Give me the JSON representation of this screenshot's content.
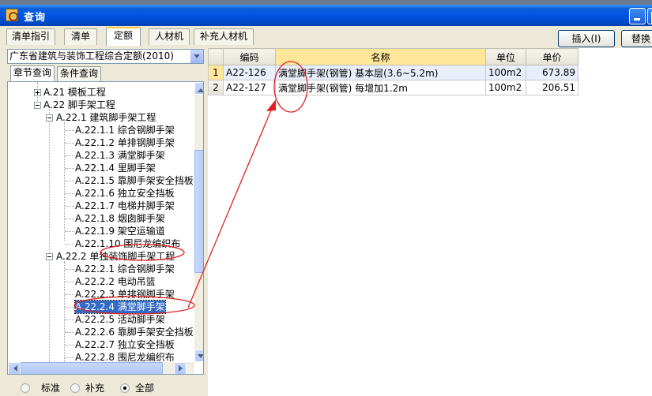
{
  "window": {
    "title": "查询"
  },
  "tabs": [
    {
      "label": "清单指引",
      "active": false
    },
    {
      "label": "清单",
      "active": false
    },
    {
      "label": "定额",
      "active": true
    },
    {
      "label": "人材机",
      "active": false
    },
    {
      "label": "补充人材机",
      "active": false
    }
  ],
  "buttons": {
    "insert": "插入(I)",
    "replace": "替换"
  },
  "quota_library": {
    "selected": "广东省建筑与装饰工程综合定额(2010)"
  },
  "subtabs": [
    {
      "label": "章节查询",
      "active": true
    },
    {
      "label": "条件查询",
      "active": false
    }
  ],
  "tree": [
    {
      "label": "A.21 模板工程"
    },
    {
      "label": "A.22 脚手架工程"
    },
    {
      "label": "A.22.1 建筑脚手架工程"
    },
    {
      "label": "A.22.1.1 综合钢脚手架"
    },
    {
      "label": "A.22.1.2 单排钢脚手架"
    },
    {
      "label": "A.22.1.3 满堂脚手架"
    },
    {
      "label": "A.22.1.4 里脚手架"
    },
    {
      "label": "A.22.1.5 靠脚手架安全挡板"
    },
    {
      "label": "A.22.1.6 独立安全挡板"
    },
    {
      "label": "A.22.1.7 电梯井脚手架"
    },
    {
      "label": "A.22.1.8 烟囱脚手架"
    },
    {
      "label": "A.22.1.9 架空运输道"
    },
    {
      "label": "A.22.1.10 围尼龙编织布"
    },
    {
      "label": "A.22.2 单独装饰脚手架工程"
    },
    {
      "label": "A.22.2.1 综合钢脚手架"
    },
    {
      "label": "A.22.2.2 电动吊篮"
    },
    {
      "label": "A.22.2.3 单排钢脚手架"
    },
    {
      "label": "A.22.2.4 满堂脚手架"
    },
    {
      "label": "A.22.2.5 活动脚手架"
    },
    {
      "label": "A.22.2.6 靠脚手架安全挡板"
    },
    {
      "label": "A.22.2.7 独立安全挡板"
    },
    {
      "label": "A.22.2.8 围尼龙编织布"
    }
  ],
  "filter": {
    "options": [
      "标准",
      "补充",
      "全部"
    ],
    "selected": "全部"
  },
  "grid": {
    "columns": [
      "编码",
      "名称",
      "单位",
      "单价"
    ],
    "rows": [
      {
        "no": "1",
        "code": "A22-126",
        "name": "满堂脚手架(钢管) 基本层(3.6~5.2m)",
        "unit": "100m2",
        "price": "673.89"
      },
      {
        "no": "2",
        "code": "A22-127",
        "name": "满堂脚手架(钢管) 每增加1.2m",
        "unit": "100m2",
        "price": "206.51"
      }
    ]
  },
  "annotation_color": "#e02020"
}
